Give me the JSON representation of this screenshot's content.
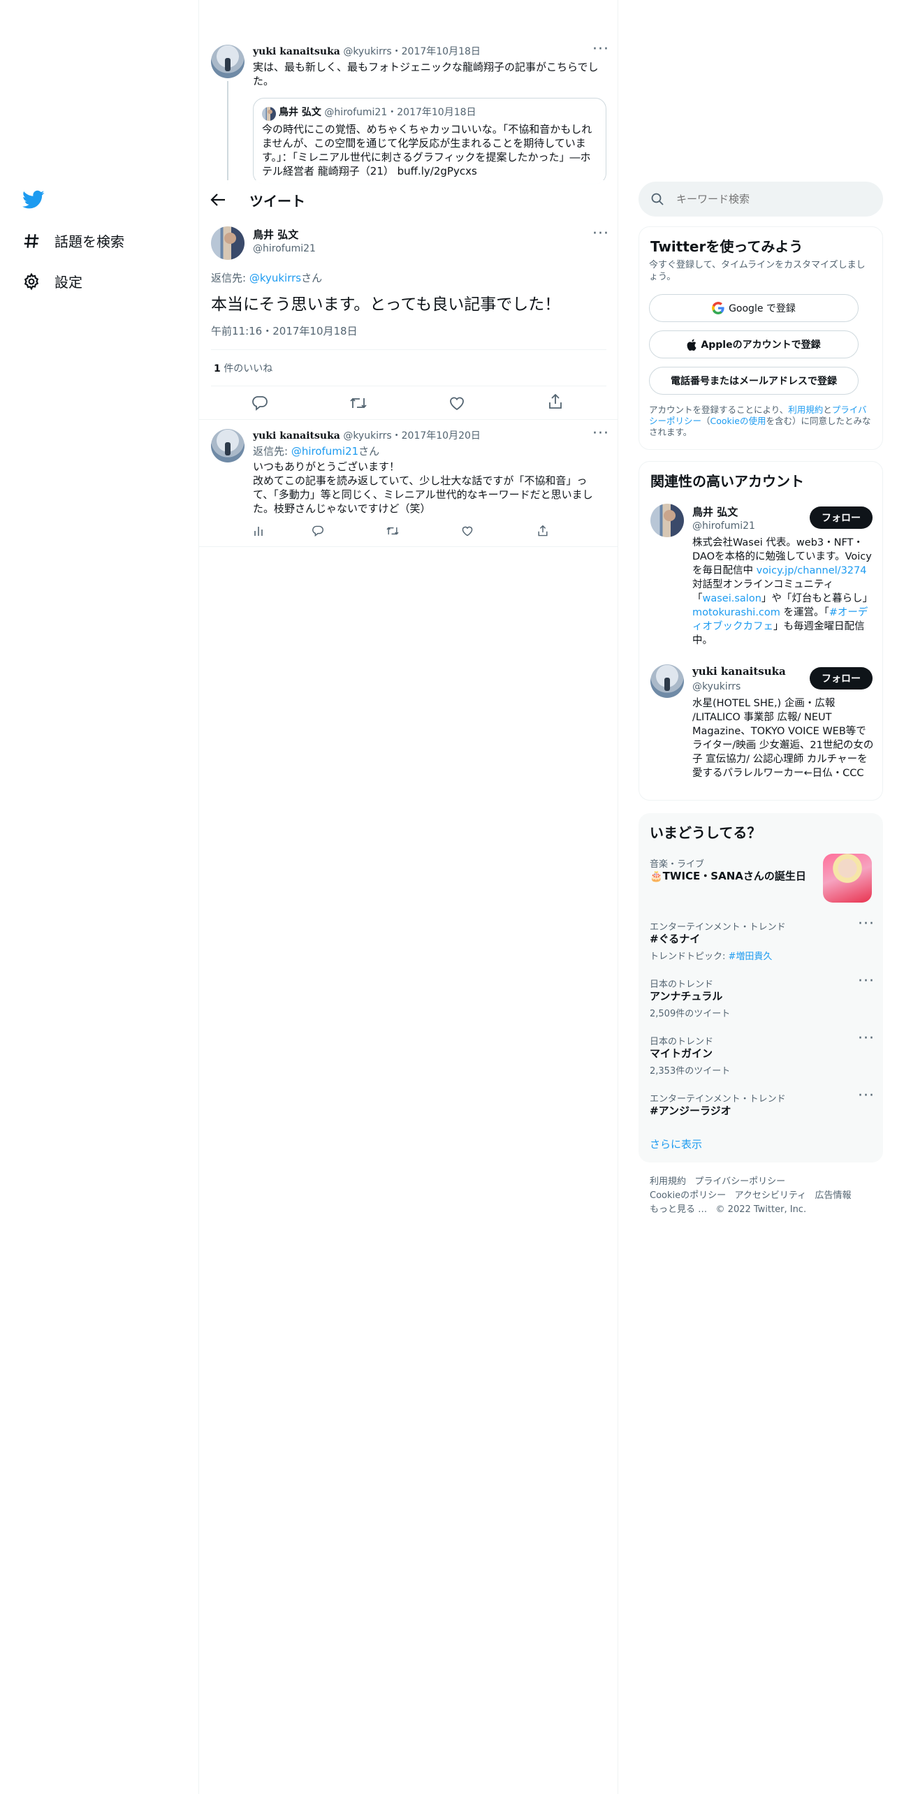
{
  "nav": {
    "explore_label": "話題を検索",
    "settings_label": "設定"
  },
  "header": {
    "title": "ツイート"
  },
  "parent_tweet": {
    "name": "yuki kanaitsuka",
    "handle": "@kyukirrs",
    "date": "2017年10月18日",
    "text": "実は、最も新しく、最もフォトジェニックな龍崎翔子の記事がこちらでした。",
    "quote": {
      "name": "鳥井 弘文",
      "handle": "@hirofumi21",
      "date": "2017年10月18日",
      "text": "今の時代にこの覚悟、めちゃくちゃカッコいいな。「不協和音かもしれませんが、この空間を通じて化学反応が生まれることを期待しています。」：「ミレニアル世代に刺さるグラフィックを提案したかった」―ホテル経営者 龍崎翔子（21） buff.ly/2gPycxs"
    }
  },
  "main_tweet": {
    "name": "鳥井 弘文",
    "handle": "@hirofumi21",
    "reply_prefix": "返信先: ",
    "reply_to": "@kyukirrs",
    "reply_suffix": "さん",
    "text": "本当にそう思います。とっても良い記事でした！",
    "timestamp": "午前11:16・2017年10月18日",
    "likes_count": "1",
    "likes_label": " 件のいいね"
  },
  "reply_tweet": {
    "name": "yuki kanaitsuka",
    "handle": "@kyukirrs",
    "date": "2017年10月20日",
    "reply_prefix": "返信先: ",
    "reply_to": "@hirofumi21",
    "reply_suffix": "さん",
    "line1": "いつもありがとうございます！",
    "line2": "改めてこの記事を読み返していて、少し壮大な話ですが「不協和音」って、「多動力」等と同じく、ミレニアル世代的なキーワードだと思いました。枝野さんじゃないですけど（笑）"
  },
  "search": {
    "placeholder": "キーワード検索"
  },
  "signup": {
    "title": "Twitterを使ってみよう",
    "subtitle": "今すぐ登録して、タイムラインをカスタマイズしましょう。",
    "google": "Google で登録",
    "apple": "Appleのアカウントで登録",
    "phone": "電話番号またはメールアドレスで登録",
    "terms_pre": "アカウントを登録することにより、",
    "terms_link1": "利用規約",
    "terms_and": "と",
    "terms_link2": "プライバシーポリシー",
    "terms_paren": "（",
    "terms_link3": "Cookieの使用",
    "terms_post": "を含む）に同意したとみなされます。"
  },
  "related": {
    "title": "関連性の高いアカウント",
    "follow_label": "フォロー",
    "accounts": [
      {
        "name": "鳥井 弘文",
        "handle": "@hirofumi21",
        "bio_a": "株式会社Wasei 代表。web3・NFT・DAOを本格的に勉強しています。Voicyを毎日配信中 ",
        "bio_link1": "voicy.jp/channel/3274",
        "bio_b": " 対話型オンラインコミュニティ「",
        "bio_link2": "wasei.salon",
        "bio_c": "」や「灯台もと暮らし」",
        "bio_link3": "motokurashi.com",
        "bio_d": " を運営。「",
        "bio_link4": "#オーディオブックカフェ",
        "bio_e": "」も毎週金曜日配信中。"
      },
      {
        "name": "yuki kanaitsuka",
        "handle": "@kyukirrs",
        "bio": "水星(HOTEL SHE,) 企画・広報 /LITALICO 事業部 広報/ NEUT Magazine、TOKYO VOICE WEB等でライター/映画 少女邂逅、21世紀の女の子 宣伝協力/ 公認心理師 カルチャーを愛するパラレルワーカー←日仏・CCC"
      }
    ]
  },
  "trends": {
    "title": "いまどうしてる？",
    "items": [
      {
        "context": "音楽・ライブ",
        "name": "🎂TWICE・SANAさんの誕生日",
        "meta": ""
      },
      {
        "context": "エンターテインメント・トレンド",
        "name": "#ぐるナイ",
        "meta_pre": "トレンドトピック: ",
        "meta_link": "#増田貴久"
      },
      {
        "context": "日本のトレンド",
        "name": "アンナチュラル",
        "meta": "2,509件のツイート"
      },
      {
        "context": "日本のトレンド",
        "name": "マイトガイン",
        "meta": "2,353件のツイート"
      },
      {
        "context": "エンターテインメント・トレンド",
        "name": "#アンジーラジオ",
        "meta": ""
      }
    ],
    "show_more": "さらに表示"
  },
  "footer": {
    "links": [
      "利用規約",
      "プライバシーポリシー",
      "Cookieのポリシー",
      "アクセシビリティ",
      "広告情報",
      "もっと見る …"
    ],
    "copyright": "© 2022 Twitter, Inc."
  },
  "colors": {
    "accent": "#1d9bf0",
    "text": "#0f1419",
    "muted": "#536471",
    "border": "#eff3f4",
    "panel": "#f7f9f9"
  }
}
